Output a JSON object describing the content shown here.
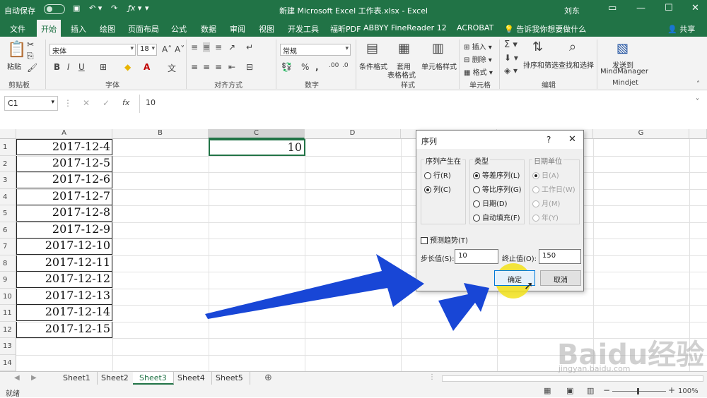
{
  "titlebar": {
    "autosave": "自动保存",
    "title": "新建 Microsoft Excel 工作表.xlsx - Excel",
    "user": "刘东"
  },
  "tabs": [
    "文件",
    "开始",
    "插入",
    "绘图",
    "页面布局",
    "公式",
    "数据",
    "审阅",
    "视图",
    "开发工具",
    "福昕PDF",
    "ABBYY FineReader 12",
    "ACROBAT",
    "告诉我你想要做什么",
    "共享"
  ],
  "ribbon": {
    "paste": "粘贴",
    "font_name": "宋体",
    "font_size": "18",
    "number_format": "常规",
    "cond_format": "条件格式",
    "table_format_1": "套用",
    "table_format_2": "表格格式",
    "cell_style": "单元格样式",
    "insert": "插入",
    "delete": "删除",
    "format": "格式",
    "sort_filter": "排序和筛选",
    "find_select": "查找和选择",
    "send_to": "发送到",
    "mindmanager": "MindManager",
    "groups": {
      "clipboard": "剪贴板",
      "font": "字体",
      "align": "对齐方式",
      "number": "数字",
      "styles": "样式",
      "cells": "单元格",
      "edit": "编辑",
      "mindjet": "Mindjet"
    }
  },
  "formula_bar": {
    "name_box": "C1",
    "fx": "fx",
    "value": "10"
  },
  "columns": [
    "A",
    "B",
    "C",
    "D",
    "E",
    "F",
    "G"
  ],
  "rows": [
    "1",
    "2",
    "3",
    "4",
    "5",
    "6",
    "7",
    "8",
    "9",
    "10",
    "11",
    "12",
    "13",
    "14"
  ],
  "cells_A": [
    "2017-12-4",
    "2017-12-5",
    "2017-12-6",
    "2017-12-7",
    "2017-12-8",
    "2017-12-9",
    "2017-12-10",
    "2017-12-11",
    "2017-12-12",
    "2017-12-13",
    "2017-12-14",
    "2017-12-15"
  ],
  "cell_C1": "10",
  "sheets": [
    "Sheet1",
    "Sheet2",
    "Sheet3",
    "Sheet4",
    "Sheet5"
  ],
  "active_sheet": "Sheet3",
  "status": {
    "left": "就绪",
    "zoom": "100%"
  },
  "dialog": {
    "title": "序列",
    "help": "?",
    "series_in": "序列产生在",
    "row": "行(R)",
    "col": "列(C)",
    "type": "类型",
    "linear": "等差序列(L)",
    "growth": "等比序列(G)",
    "date": "日期(D)",
    "autofill": "自动填充(F)",
    "date_unit": "日期单位",
    "day": "日(A)",
    "weekday": "工作日(W)",
    "month": "月(M)",
    "year": "年(Y)",
    "trend": "预测趋势(T)",
    "step_label": "步长值(S):",
    "step_value": "10",
    "stop_label": "终止值(O):",
    "stop_value": "150",
    "ok": "确定",
    "cancel": "取消"
  },
  "watermark": {
    "logo": "Baidu经验",
    "url": "jingyan.baidu.com"
  },
  "colors": {
    "excel_green": "#217346",
    "arrow_blue": "#1846d6",
    "cursor_highlight": "#f2e21a"
  }
}
